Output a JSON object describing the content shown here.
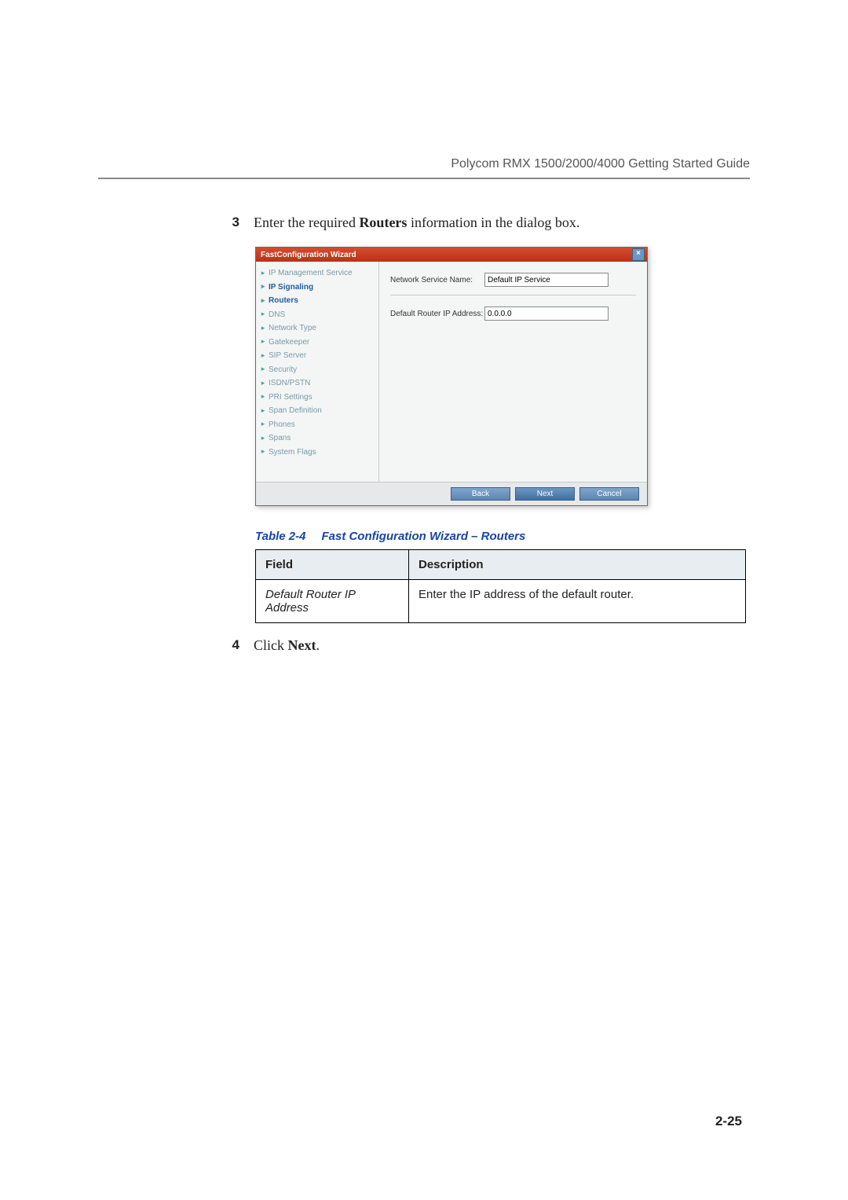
{
  "header": {
    "running_title": "Polycom RMX 1500/2000/4000 Getting Started Guide"
  },
  "steps": {
    "s3": {
      "num": "3",
      "pre": "Enter the required ",
      "bold": "Routers",
      "post": " information in the dialog box."
    },
    "s4": {
      "num": "4",
      "pre": "Click ",
      "bold": "Next",
      "post": "."
    }
  },
  "dialog": {
    "title": "FastConfiguration Wizard",
    "close_glyph": "×",
    "sidebar": [
      {
        "label": "IP Management Service",
        "style": "muted"
      },
      {
        "label": "IP Signaling",
        "style": "bold-blue"
      },
      {
        "label": "Routers",
        "style": "sel"
      },
      {
        "label": "DNS",
        "style": "muted"
      },
      {
        "label": "Network Type",
        "style": "muted"
      },
      {
        "label": "Gatekeeper",
        "style": "muted"
      },
      {
        "label": "SIP Server",
        "style": "muted"
      },
      {
        "label": "Security",
        "style": "muted"
      },
      {
        "label": "ISDN/PSTN",
        "style": "muted"
      },
      {
        "label": "PRI Settings",
        "style": "muted"
      },
      {
        "label": "Span Definition",
        "style": "muted"
      },
      {
        "label": "Phones",
        "style": "muted"
      },
      {
        "label": "Spans",
        "style": "muted"
      },
      {
        "label": "System Flags",
        "style": "muted"
      }
    ],
    "form": {
      "service_name_label": "Network Service Name:",
      "service_name_value": "Default IP Service",
      "router_ip_label": "Default Router IP Address:",
      "router_ip_value": "0.0.0.0"
    },
    "buttons": {
      "back": "Back",
      "next": "Next",
      "cancel": "Cancel"
    }
  },
  "table": {
    "caption_number": "Table 2-4",
    "caption_title": "Fast Configuration Wizard – Routers",
    "headers": {
      "field": "Field",
      "desc": "Description"
    },
    "rows": [
      {
        "field": "Default Router IP Address",
        "desc": "Enter the IP address of the default router."
      }
    ]
  },
  "page_number": "2-25"
}
